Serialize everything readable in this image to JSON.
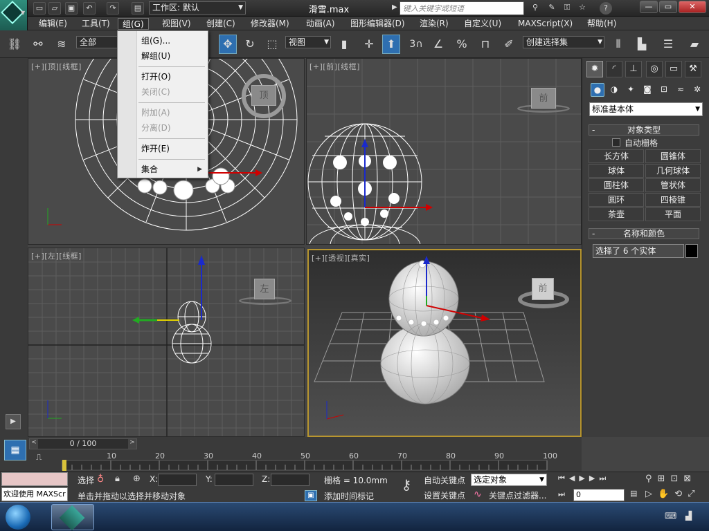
{
  "titlebar": {
    "workspace_label": "工作区: 默认",
    "file_title": "滑雪.max",
    "search_placeholder": "键入关键字或短语",
    "help_label": "?"
  },
  "menubar": {
    "items": [
      "编辑(E)",
      "工具(T)",
      "组(G)",
      "视图(V)",
      "创建(C)",
      "修改器(M)",
      "动画(A)",
      "图形编辑器(D)",
      "渲染(R)",
      "自定义(U)",
      "MAXScript(X)",
      "帮助(H)"
    ],
    "active_index": 2
  },
  "group_menu": {
    "items": [
      {
        "label": "组(G)...",
        "enabled": true
      },
      {
        "label": "解组(U)",
        "enabled": true
      },
      {
        "label": "打开(O)",
        "enabled": true
      },
      {
        "label": "关闭(C)",
        "enabled": false
      },
      {
        "label": "附加(A)",
        "enabled": false
      },
      {
        "label": "分离(D)",
        "enabled": false
      },
      {
        "label": "炸开(E)",
        "enabled": true
      },
      {
        "label": "集合",
        "enabled": true,
        "submenu": true
      }
    ]
  },
  "toolbar": {
    "selection_filter": "全部",
    "ref_coord": "视图",
    "named_selection": "创建选择集",
    "snap_angle_label": "3"
  },
  "viewports": {
    "top": {
      "label": "[+][顶][线框]",
      "cube_label": "顶"
    },
    "front": {
      "label": "[+][前][线框]",
      "cube_label": "前"
    },
    "left": {
      "label": "[+][左][线框]",
      "cube_label": "左"
    },
    "perspective": {
      "label": "[+][透视][真实]",
      "cube_label": "前"
    }
  },
  "command_panel": {
    "category": "标准基本体",
    "object_type_title": "对象类型",
    "autogrid_label": "自动栅格",
    "primitives": [
      "长方体",
      "圆锥体",
      "球体",
      "几何球体",
      "圆柱体",
      "管状体",
      "圆环",
      "四棱锥",
      "茶壶",
      "平面"
    ],
    "name_color_title": "名称和颜色",
    "name_value": "选择了 6 个实体",
    "object_color": "#000000"
  },
  "timeline": {
    "frame_display": "0 / 100",
    "ticks": [
      "10",
      "20",
      "30",
      "40",
      "50",
      "60",
      "70",
      "80",
      "90",
      "100"
    ],
    "current_frame": 0,
    "total_frames": 100
  },
  "statusbar": {
    "welcome": "欢迎使用 MAXScr",
    "selection_label": "选择",
    "x_label": "X:",
    "y_label": "Y:",
    "z_label": "Z:",
    "grid_label": "栅格 = 10.0mm",
    "prompt": "单击并拖动以选择并移动对象",
    "add_time_tag": "添加时间标记",
    "auto_key": "自动关键点",
    "set_key": "设置关键点",
    "key_mode": "选定对象",
    "key_filters": "关键点过滤器...",
    "frame_field": "0"
  },
  "colors": {
    "accent": "#2e6fb0",
    "axis_x": "#d00000",
    "axis_y": "#22aa22",
    "axis_z": "#1a2acc",
    "perspective_frame": "#b8962f"
  }
}
